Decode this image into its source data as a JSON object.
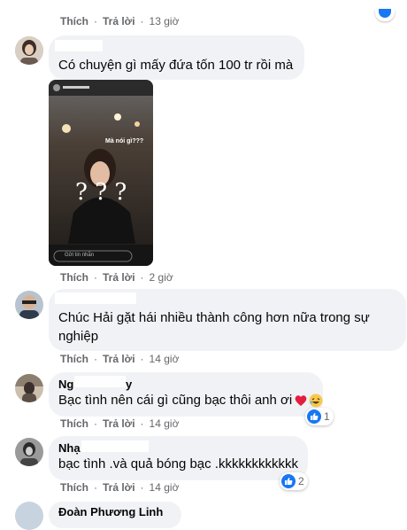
{
  "labels": {
    "like": "Thích",
    "reply": "Trả lời",
    "dot": "·"
  },
  "top_row": {
    "time": "13 giờ"
  },
  "comments": [
    {
      "text": "Có chuyện gì mấy đứa tốn 100 tr rồi mà",
      "time": "2 giờ",
      "story": {
        "caption": "Mà nói gì???",
        "doodle": "? ? ?",
        "reply_placeholder": "Gửi tin nhắn"
      }
    },
    {
      "text_line1": "Chúc Hải gặt hái nhiều thành công hơn nữa trong sự",
      "text_line2": "nghiệp",
      "time": "14 giờ"
    },
    {
      "name_left": "Ng",
      "name_right": "y",
      "text": "Bạc tình nên cái gì cũng bạc thôi anh ơi",
      "time": "14 giờ",
      "reaction_count": "1"
    },
    {
      "name": "Nhạ",
      "text": "bạc tình .và quả bóng bạc .kkkkkkkkkkkk",
      "time": "14 giờ",
      "reaction_count": "2"
    },
    {
      "name": "Đoàn Phương Linh"
    }
  ],
  "colors": {
    "bubble": "#f0f2f5",
    "meta": "#65676b",
    "like_blue": "#1877f2",
    "heart": "#e41e3f"
  }
}
